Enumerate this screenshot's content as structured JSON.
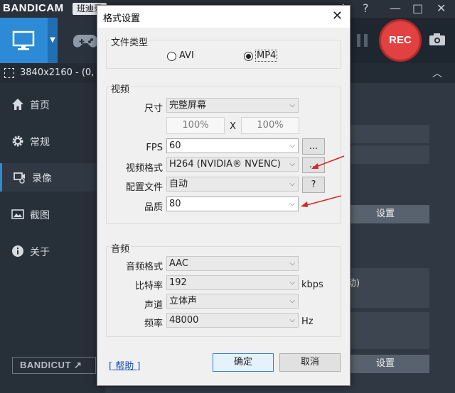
{
  "app": {
    "logo": "BANDICAM",
    "subtitle": "班迪录",
    "resolution": "3840x2160 - (0, 0)",
    "rec_label": "REC",
    "bandicut_label": "BANDICUT ↗"
  },
  "sidebar": {
    "items": [
      {
        "label": "首页",
        "icon": "home-icon"
      },
      {
        "label": "常规",
        "icon": "gear-icon"
      },
      {
        "label": "录像",
        "icon": "video-settings-icon"
      },
      {
        "label": "截图",
        "icon": "image-icon"
      },
      {
        "label": "关于",
        "icon": "info-icon"
      }
    ]
  },
  "background_content": {
    "settings_button_top": "设置",
    "settings_button_bottom": "设置",
    "partial_text": "动)"
  },
  "dialog": {
    "title": "格式设置",
    "file_type": {
      "group_title": "文件类型",
      "options": [
        "AVI",
        "MP4"
      ],
      "selected": "MP4"
    },
    "video": {
      "group_title": "视频",
      "size_label": "尺寸",
      "size_value": "完整屏幕",
      "width_pct": "100%",
      "height_pct": "100%",
      "times": "X",
      "fps_label": "FPS",
      "fps_value": "60",
      "fps_more": "...",
      "codec_label": "视频格式",
      "codec_value": "H264 (NVIDIA® NVENC)",
      "codec_more": "...",
      "profile_label": "配置文件",
      "profile_value": "自动",
      "profile_help": "?",
      "quality_label": "品质",
      "quality_value": "80"
    },
    "audio": {
      "group_title": "音频",
      "codec_label": "音频格式",
      "codec_value": "AAC",
      "bitrate_label": "比特率",
      "bitrate_value": "192",
      "bitrate_unit": "kbps",
      "channels_label": "声道",
      "channels_value": "立体声",
      "frequency_label": "频率",
      "frequency_value": "48000",
      "frequency_unit": "Hz"
    },
    "help_link": "[ 帮助 ]",
    "ok": "确定",
    "cancel": "取消"
  },
  "colors": {
    "accent": "#2d8ad6",
    "rec": "#e14141",
    "annotation_arrow": "#d9262a"
  }
}
